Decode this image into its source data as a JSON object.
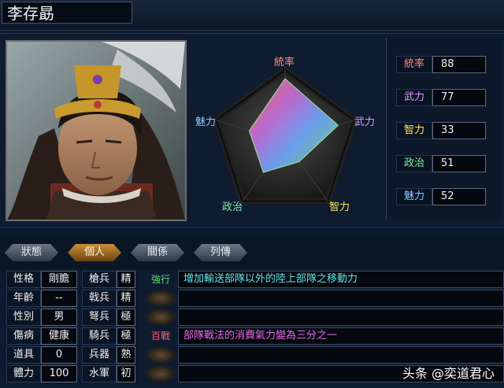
{
  "officer": {
    "name": "李存勗"
  },
  "radar": {
    "labels": [
      "統率",
      "武力",
      "智力",
      "政治",
      "魅力"
    ],
    "label_colors": [
      "#ff8a8a",
      "#d99cff",
      "#ffe75a",
      "#7df0a8",
      "#8fc6ff"
    ],
    "max": 100
  },
  "stats": [
    {
      "label": "統率",
      "value": "88",
      "color": "#ff8a8a"
    },
    {
      "label": "武力",
      "value": "77",
      "color": "#d99cff"
    },
    {
      "label": "智力",
      "value": "33",
      "color": "#ffe75a"
    },
    {
      "label": "政治",
      "value": "51",
      "color": "#7df0a8"
    },
    {
      "label": "魅力",
      "value": "52",
      "color": "#8fc6ff"
    }
  ],
  "tabs": [
    {
      "label": "狀態",
      "active": false
    },
    {
      "label": "個人",
      "active": true
    },
    {
      "label": "關係",
      "active": false
    },
    {
      "label": "列傳",
      "active": false
    }
  ],
  "personal": [
    {
      "label": "性格",
      "value": "剛膽"
    },
    {
      "label": "年齡",
      "value": "--"
    },
    {
      "label": "性別",
      "value": "男"
    },
    {
      "label": "傷病",
      "value": "健康"
    },
    {
      "label": "道具",
      "value": "0"
    },
    {
      "label": "體力",
      "value": "100"
    }
  ],
  "aptitudes": [
    {
      "label": "槍兵",
      "value": "精"
    },
    {
      "label": "戟兵",
      "value": "精"
    },
    {
      "label": "弩兵",
      "value": "極"
    },
    {
      "label": "騎兵",
      "value": "極"
    },
    {
      "label": "兵器",
      "value": "熟"
    },
    {
      "label": "水軍",
      "value": "初"
    }
  ],
  "skills": [
    {
      "tag": "強行",
      "desc": "增加輸送部隊以外的陸上部隊之移動力",
      "tag_color": "#59e07a",
      "desc_color": "#5fe6e6"
    },
    {
      "tag": "",
      "desc": "",
      "tag_color": "",
      "desc_color": ""
    },
    {
      "tag": "",
      "desc": "",
      "tag_color": "",
      "desc_color": ""
    },
    {
      "tag": "百戰",
      "desc": "部隊戰法的消費氣力變為三分之一",
      "tag_color": "#ff5a7a",
      "desc_color": "#e86ae8"
    },
    {
      "tag": "",
      "desc": "",
      "tag_color": "",
      "desc_color": ""
    },
    {
      "tag": "",
      "desc": "",
      "tag_color": "",
      "desc_color": ""
    }
  ],
  "watermark": "头条 @奕道君心"
}
